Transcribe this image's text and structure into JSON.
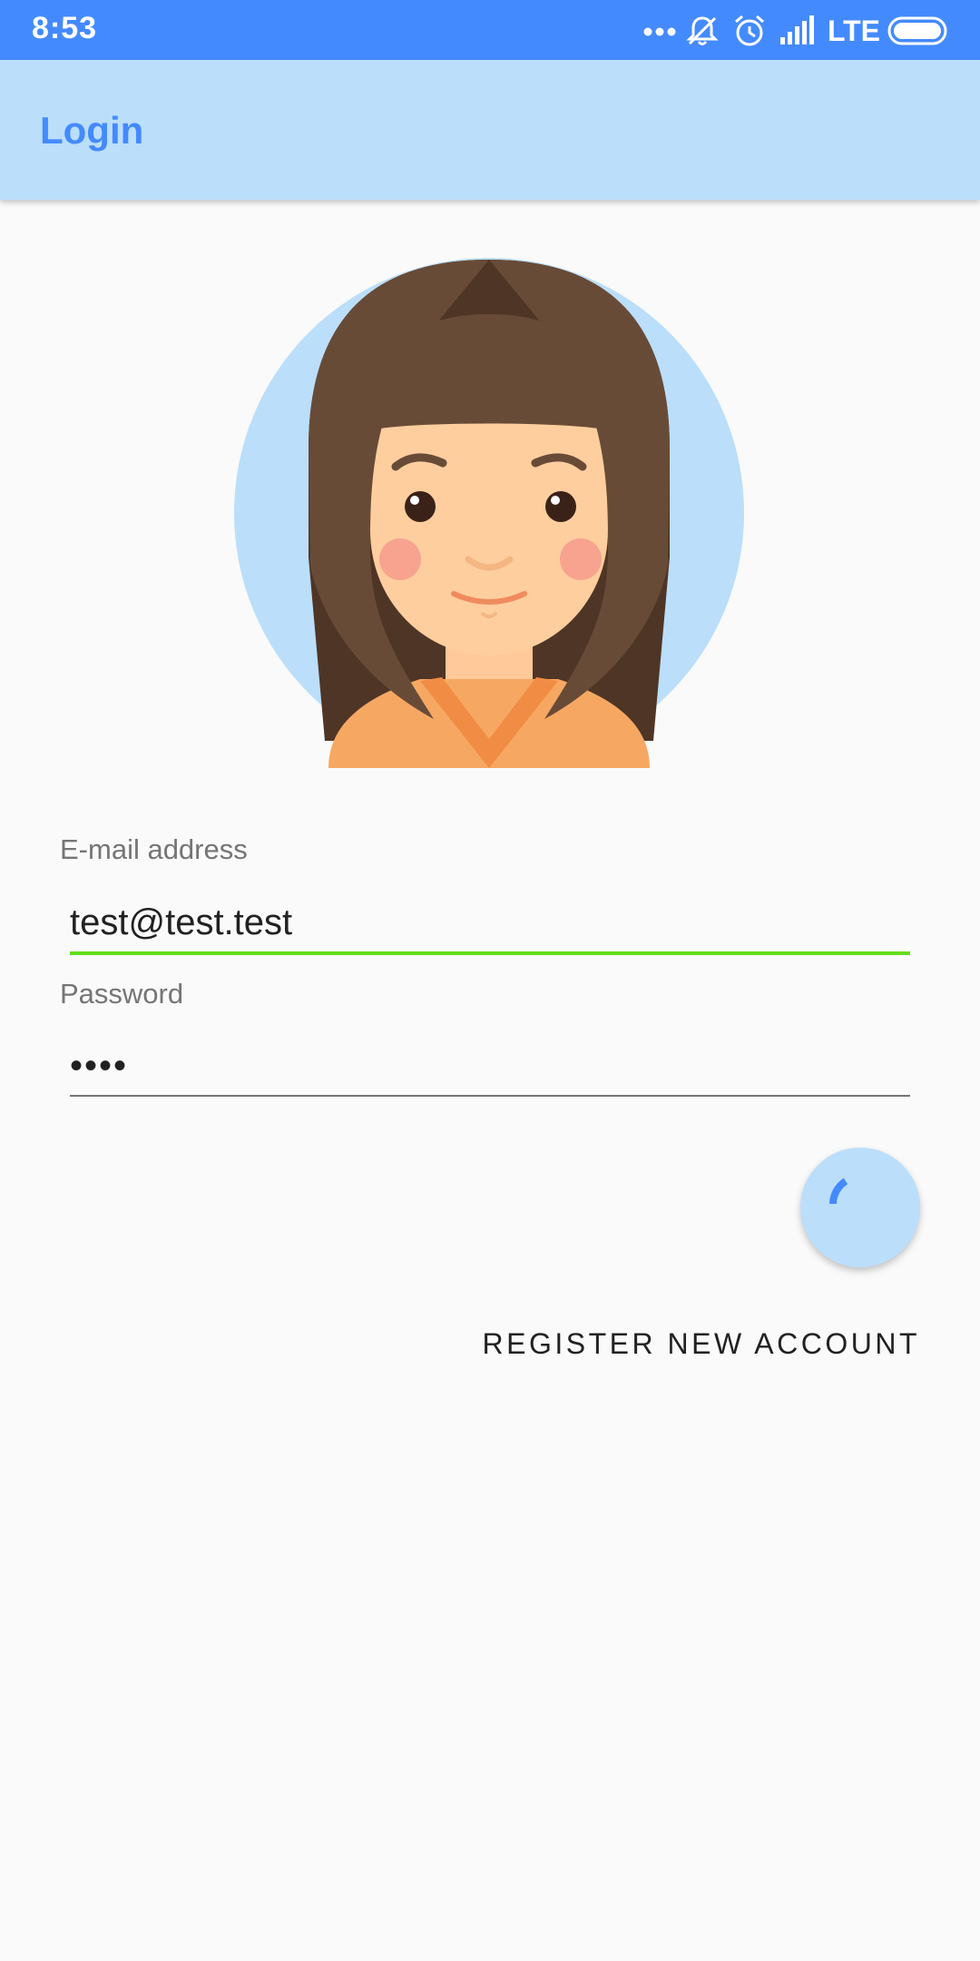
{
  "status_bar": {
    "time": "8:53",
    "network": "LTE",
    "icons": [
      "more-dots-icon",
      "notifications-off-icon",
      "alarm-icon",
      "signal-icon",
      "battery-icon"
    ]
  },
  "app_bar": {
    "title": "Login"
  },
  "avatar": {
    "icon": "user-avatar-girl-illustration"
  },
  "form": {
    "email": {
      "label": "E-mail address",
      "value": "test@test.test",
      "focused": true
    },
    "password": {
      "label": "Password",
      "value": "••••"
    }
  },
  "login_fab": {
    "state": "loading",
    "icon": "progress-spinner-icon"
  },
  "register_button": {
    "label": "REGISTER NEW ACCOUNT"
  },
  "colors": {
    "status_bar": "#448aff",
    "app_bar": "#bbdefb",
    "accent": "#448aff",
    "focused_underline": "#64dd17",
    "background": "#fafafa"
  }
}
